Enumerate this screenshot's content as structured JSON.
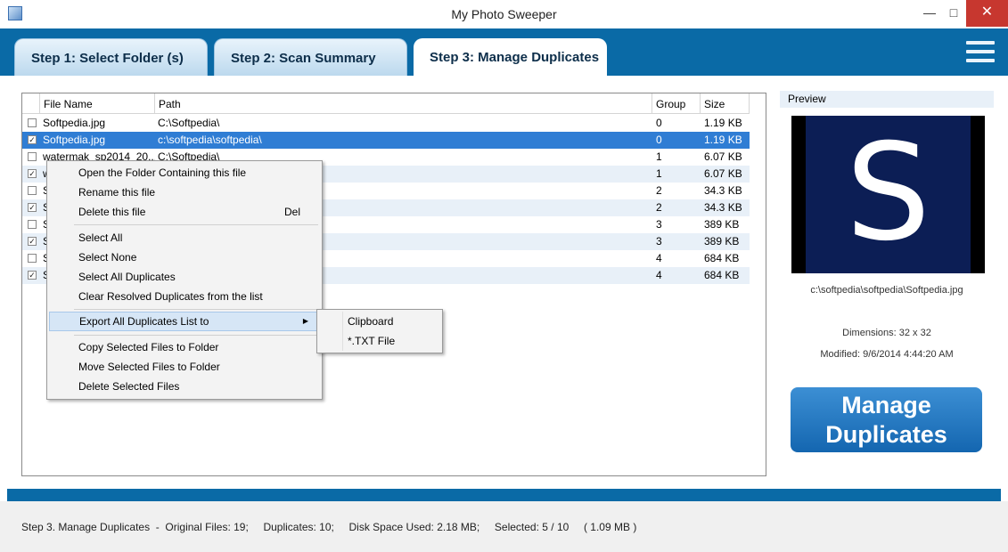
{
  "window": {
    "title": "My Photo Sweeper",
    "close_glyph": "✕",
    "minimize_glyph": "—",
    "maximize_glyph": "□"
  },
  "tabs": [
    {
      "label": "Step 1: Select Folder (s)"
    },
    {
      "label": "Step 2: Scan Summary"
    },
    {
      "label": "Step 3: Manage Duplicates"
    }
  ],
  "grid": {
    "columns": [
      "File Name",
      "Path",
      "Group",
      "Size"
    ],
    "rows": [
      {
        "checked": false,
        "name": "Softpedia.jpg",
        "path": "C:\\Softpedia\\",
        "group": "0",
        "size": "1.19 KB"
      },
      {
        "checked": true,
        "name": "Softpedia.jpg",
        "path": "c:\\softpedia\\softpedia\\",
        "group": "0",
        "size": "1.19 KB"
      },
      {
        "checked": false,
        "name": "watermak_sp2014_20...",
        "path": "C:\\Softpedia\\",
        "group": "1",
        "size": "6.07 KB"
      },
      {
        "checked": true,
        "name": "w",
        "path": "",
        "group": "1",
        "size": "6.07 KB"
      },
      {
        "checked": false,
        "name": "S",
        "path": "",
        "group": "2",
        "size": "34.3 KB"
      },
      {
        "checked": true,
        "name": "S",
        "path": "",
        "group": "2",
        "size": "34.3 KB"
      },
      {
        "checked": false,
        "name": "S",
        "path": "",
        "group": "3",
        "size": "389 KB"
      },
      {
        "checked": true,
        "name": "S",
        "path": "",
        "group": "3",
        "size": "389 KB"
      },
      {
        "checked": false,
        "name": "S",
        "path": "",
        "group": "4",
        "size": "684 KB"
      },
      {
        "checked": true,
        "name": "S",
        "path": "",
        "group": "4",
        "size": "684 KB"
      }
    ]
  },
  "context_menu": {
    "open_folder": "Open the Folder Containing this file",
    "rename": "Rename this file",
    "delete": "Delete this file",
    "delete_shortcut": "Del",
    "select_all": "Select All",
    "select_none": "Select None",
    "select_all_duplicates": "Select All Duplicates",
    "clear_resolved": "Clear Resolved Duplicates from the list",
    "export": "Export All Duplicates List to",
    "copy_selected": "Copy Selected Files to Folder",
    "move_selected": "Move Selected Files to Folder",
    "delete_selected": "Delete Selected Files"
  },
  "submenu": {
    "clipboard": "Clipboard",
    "txt_file": "*.TXT File"
  },
  "preview": {
    "label": "Preview",
    "image_letter": "S",
    "path": "c:\\softpedia\\softpedia\\Softpedia.jpg",
    "dimensions": "Dimensions: 32 x 32",
    "modified": "Modified: 9/6/2014 4:44:20 AM"
  },
  "manage_button": {
    "line1": "Manage",
    "line2": "Duplicates"
  },
  "status": {
    "text": "Step 3. Manage Duplicates  -  Original Files: 19;     Duplicates: 10;     Disk Space Used: 2.18 MB;     Selected: 5 / 10     ( 1.09 MB )"
  }
}
